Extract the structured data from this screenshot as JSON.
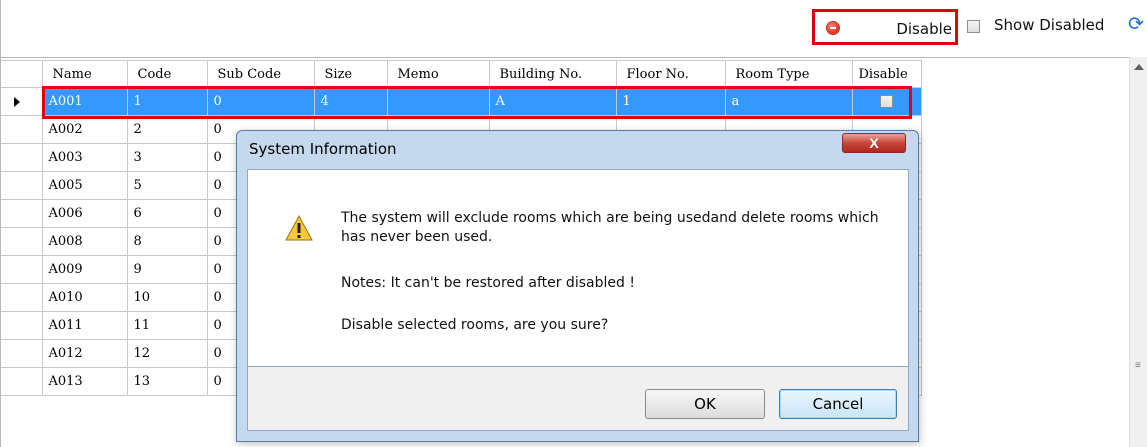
{
  "toolbar": {
    "disable_label": "Disable",
    "show_disabled_label": "Show Disabled",
    "show_disabled_checked": false
  },
  "grid": {
    "columns": [
      "Name",
      "Code",
      "Sub Code",
      "Size",
      "Memo",
      "Building No.",
      "Floor No.",
      "Room Type",
      "Disable"
    ],
    "rows": [
      {
        "name": "A001",
        "code": "1",
        "sub_code": "0",
        "size": "4",
        "memo": "",
        "building": "A",
        "floor": "1",
        "room_type": "a",
        "disabled": false,
        "selected": true
      },
      {
        "name": "A002",
        "code": "2",
        "sub_code": "0"
      },
      {
        "name": "A003",
        "code": "3",
        "sub_code": "0"
      },
      {
        "name": "A005",
        "code": "5",
        "sub_code": "0"
      },
      {
        "name": "A006",
        "code": "6",
        "sub_code": "0"
      },
      {
        "name": "A008",
        "code": "8",
        "sub_code": "0"
      },
      {
        "name": "A009",
        "code": "9",
        "sub_code": "0"
      },
      {
        "name": "A010",
        "code": "10",
        "sub_code": "0"
      },
      {
        "name": "A011",
        "code": "11",
        "sub_code": "0"
      },
      {
        "name": "A012",
        "code": "12",
        "sub_code": "0"
      },
      {
        "name": "A013",
        "code": "13",
        "sub_code": "0"
      }
    ]
  },
  "dialog": {
    "title": "System Information",
    "close_label": "X",
    "message_line1": "The system will exclude rooms which are being usedand delete rooms which has never been used.",
    "message_line2": "Notes: It can't be restored after disabled !",
    "message_line3": "Disable selected rooms, are you sure?",
    "ok_label": "OK",
    "cancel_label": "Cancel"
  },
  "colors": {
    "highlight_border": "#e3000f",
    "selected_row": "#3399ff",
    "dialog_frame": "#c4d8ee"
  },
  "icons": [
    "stop-icon",
    "refresh-icon",
    "warning-icon",
    "row-pointer-icon",
    "close-icon"
  ]
}
